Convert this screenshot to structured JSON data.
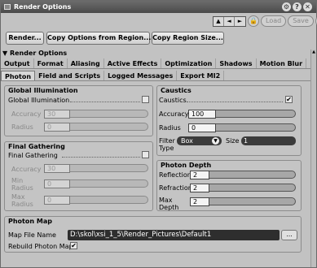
{
  "window": {
    "title": "Render Options"
  },
  "nav": {
    "up": "▲",
    "left": "◄",
    "right": "►"
  },
  "right_tools": {
    "load": "Load",
    "save": "Save",
    "help": "?"
  },
  "buttons": {
    "render": "Render...",
    "copy_from_region": "Copy Options from Region...",
    "copy_region_size": "Copy Region Size..."
  },
  "section_header": "▼ Render Options",
  "tabs_row1": [
    "Output",
    "Format",
    "Aliasing",
    "Active Effects",
    "Optimization",
    "Shadows",
    "Motion Blur"
  ],
  "tabs_row2": [
    "Photon",
    "Field and Scripts",
    "Logged Messages",
    "Export MI2"
  ],
  "active_tab": "Photon",
  "global_illumination": {
    "title": "Global Illumination",
    "enable_label": "Global Illumination",
    "accuracy_label": "Accuracy",
    "accuracy_value": "30",
    "radius_label": "Radius",
    "radius_value": "0"
  },
  "final_gathering": {
    "title": "Final Gathering",
    "enable_label": "Final Gathering",
    "accuracy_label": "Accuracy",
    "accuracy_value": "30",
    "min_radius_label": "Min Radius",
    "min_radius_value": "0",
    "max_radius_label": "Max Radius",
    "max_radius_value": "0"
  },
  "caustics": {
    "title": "Caustics",
    "enable_label": "Caustics",
    "enabled": true,
    "accuracy_label": "Accuracy",
    "accuracy_value": "100",
    "radius_label": "Radius",
    "radius_value": "0",
    "filter_type_label": "Filter Type",
    "filter_type_value": "Box",
    "size_label": "Size",
    "size_value": "1"
  },
  "photon_depth": {
    "title": "Photon Depth",
    "reflection_label": "Reflection",
    "reflection_value": "2",
    "refraction_label": "Refraction",
    "refraction_value": "2",
    "max_depth_label": "Max Depth",
    "max_depth_value": "2"
  },
  "photon_map": {
    "title": "Photon Map",
    "file_name_label": "Map File Name",
    "file_name_value": "D:\\skol\\xsi_1_5\\Render_Pictures\\Default1",
    "browse_label": "...",
    "rebuild_label": "Rebuild Photon Map",
    "rebuild_checked": true
  }
}
